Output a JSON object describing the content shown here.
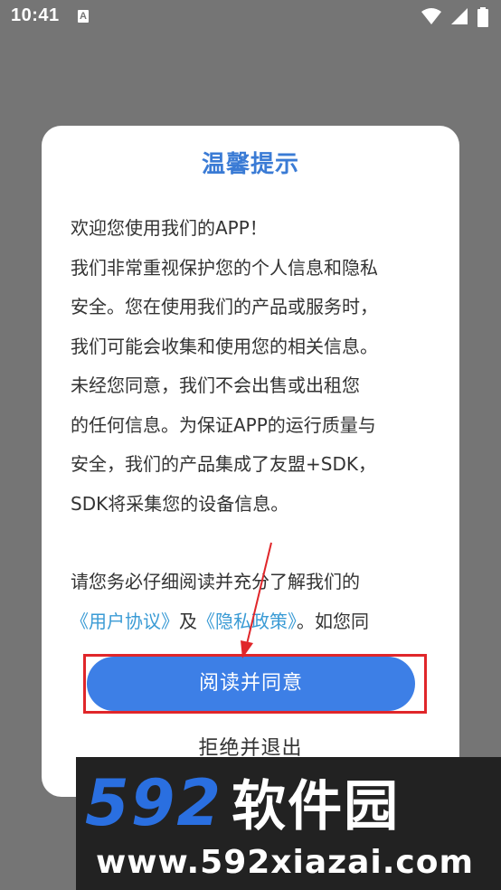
{
  "status_bar": {
    "time": "10:41",
    "notification_icon_letter": "A",
    "icons": [
      "wifi-icon",
      "cell-signal-icon",
      "battery-icon"
    ]
  },
  "dialog": {
    "title": "温馨提示",
    "lines": [
      "欢迎您使用我们的APP！",
      "我们非常重视保护您的个人信息和隐私",
      "安全。您在使用我们的产品或服务时，",
      "我们可能会收集和使用您的相关信息。",
      "未经您同意，我们不会出售或出租您",
      "的任何信息。为保证APP的运行质量与",
      "安全，我们的产品集成了友盟+SDK，",
      "SDK将采集您的设备信息。"
    ],
    "read_line": "请您务必仔细阅读并充分了解我们的",
    "user_agreement": "《用户协议》",
    "and": "及",
    "privacy_policy": "《隐私政策》",
    "tail": "。如您同",
    "agree_label": "阅读并同意",
    "decline_label": "拒绝并退出"
  },
  "watermark": {
    "logo_number": "592",
    "logo_text": "软件园",
    "url": "www.592xiazai.com"
  },
  "colors": {
    "overlay": "#757575",
    "title": "#3a7bd5",
    "link": "#3a9bd5",
    "button": "#3d7fe6",
    "highlight": "#e0262a"
  }
}
